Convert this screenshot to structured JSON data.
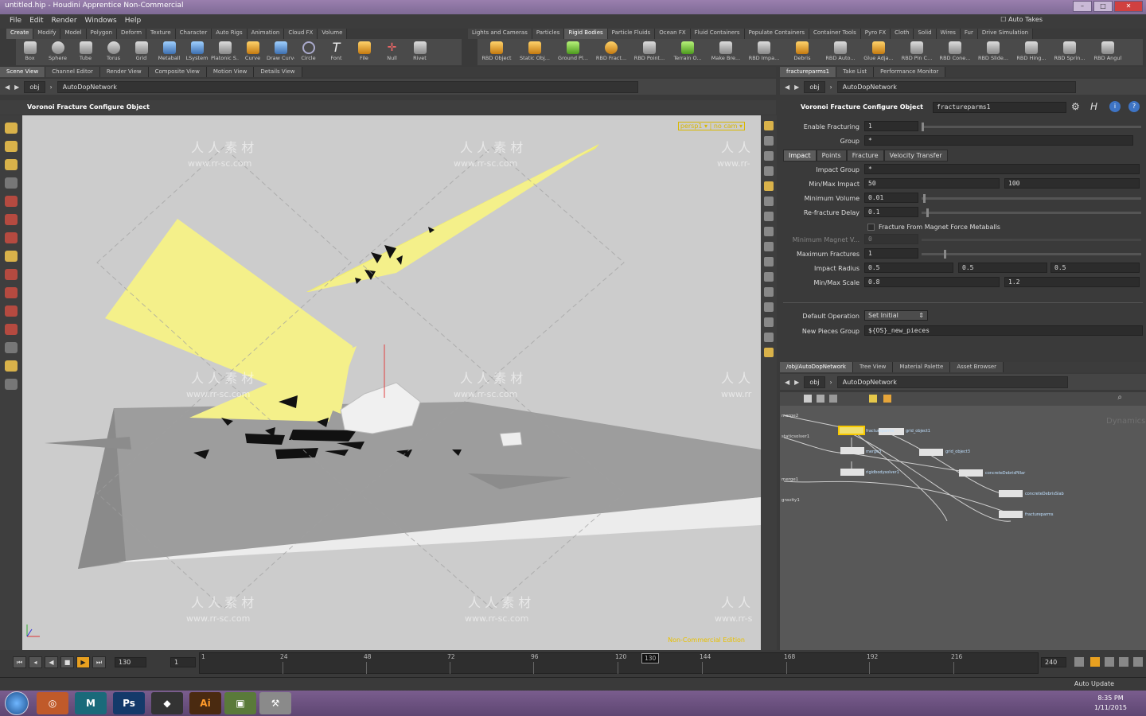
{
  "window": {
    "title": "untitled.hip - Houdini Apprentice Non-Commercial",
    "watermark": "www.rr-sc.com"
  },
  "menu": [
    "File",
    "Edit",
    "Render",
    "Windows",
    "Help"
  ],
  "auto_takes": "Auto Takes",
  "shelf_left_tabs": [
    "Create",
    "Modify",
    "Model",
    "Polygon",
    "Deform",
    "Texture",
    "Character",
    "Auto Rigs",
    "Animation",
    "Cloud FX",
    "Volume"
  ],
  "shelf_right_tabs": [
    "Lights and Cameras",
    "Particles",
    "Rigid Bodies",
    "Particle Fluids",
    "Ocean FX",
    "Fluid Containers",
    "Populate Containers",
    "Container Tools",
    "Pyro FX",
    "Cloth",
    "Solid",
    "Wires",
    "Fur",
    "Drive Simulation"
  ],
  "shelf_left_tools": [
    "Box",
    "Sphere",
    "Tube",
    "Torus",
    "Grid",
    "Metaball",
    "LSystem",
    "Platonic S...",
    "Curve",
    "Draw Curve",
    "Circle",
    "Font",
    "File",
    "Null",
    "Rivet"
  ],
  "shelf_right_tools": [
    "RBD Object",
    "Static Obj...",
    "Ground Pl...",
    "RBD Fract...",
    "RBD Point...",
    "Terrain O...",
    "Make Bre...",
    "RBD Impa...",
    "Debris",
    "RBD Auto...",
    "Glue Adja...",
    "RBD Pin C...",
    "RBD Cone...",
    "RBD Slide...",
    "RBD Hing...",
    "RBD Sprin...",
    "RBD Angul"
  ],
  "viewer_tabs": [
    "Scene View",
    "Channel Editor",
    "Render View",
    "Composite View",
    "Motion View",
    "Details View"
  ],
  "param_tabs": [
    "fractureparms1",
    "Take List",
    "Performance Monitor"
  ],
  "path": {
    "root": "obj",
    "node": "AutoDopNetwork"
  },
  "viewport": {
    "header": "Voronoi Fracture Configure Object",
    "camera": "persp1",
    "cam_mode": "no cam",
    "edition": "Non-Commercial Edition",
    "wm_cn": "人 人 素 材",
    "wm_url": "www.rr-sc.com"
  },
  "params": {
    "title": "Voronoi Fracture Configure Object",
    "node_name": "fractureparms1",
    "enable_fracturing": {
      "label": "Enable Fracturing",
      "value": "1"
    },
    "group": {
      "label": "Group",
      "value": "*"
    },
    "tabs": [
      "Impact",
      "Points",
      "Fracture",
      "Velocity Transfer"
    ],
    "impact_group": {
      "label": "Impact Group",
      "value": "*"
    },
    "minmax_impact": {
      "label": "Min/Max Impact",
      "v1": "50",
      "v2": "100"
    },
    "minimum_volume": {
      "label": "Minimum Volume",
      "value": "0.01"
    },
    "refracture_delay": {
      "label": "Re-fracture Delay",
      "value": "0.1"
    },
    "magnet_checkbox": "Fracture From Magnet Force Metaballs",
    "min_magnet": {
      "label": "Minimum Magnet V...",
      "value": "0"
    },
    "max_fractures": {
      "label": "Maximum Fractures",
      "value": "1"
    },
    "impact_radius": {
      "label": "Impact Radius",
      "v1": "0.5",
      "v2": "0.5",
      "v3": "0.5"
    },
    "minmax_scale": {
      "label": "Min/Max Scale",
      "v1": "0.8",
      "v2": "1.2"
    },
    "default_operation": {
      "label": "Default Operation",
      "value": "Set Initial"
    },
    "new_pieces_group": {
      "label": "New Pieces Group",
      "value": "${OS}_new_pieces"
    }
  },
  "network_tabs": [
    "/obj/AutoDopNetwork",
    "Tree View",
    "Material Palette",
    "Asset Browser"
  ],
  "network": {
    "context": "Dynamics",
    "nodes": [
      "merge2",
      "staticsolver1",
      "merge1",
      "gravity1",
      "fractureparms",
      "grid_object1",
      "merge3",
      "grid_object3",
      "rigidbodysolver1",
      "concreteDebrisPillar",
      "concreteDebrisSlab",
      "fractureparms"
    ]
  },
  "timeline": {
    "current": "130",
    "start": "1",
    "end": "240",
    "ticks": [
      "1",
      "24",
      "48",
      "72",
      "96",
      "120",
      "144",
      "168",
      "192",
      "216"
    ],
    "marker": "130"
  },
  "status": {
    "auto_update": "Auto Update"
  },
  "taskbar": {
    "apps": [
      "Houdini",
      "Maya",
      "Ps",
      "Unity",
      "Ai",
      "Folder",
      "Tool"
    ],
    "time": "8:35 PM",
    "date": "1/11/2015"
  }
}
